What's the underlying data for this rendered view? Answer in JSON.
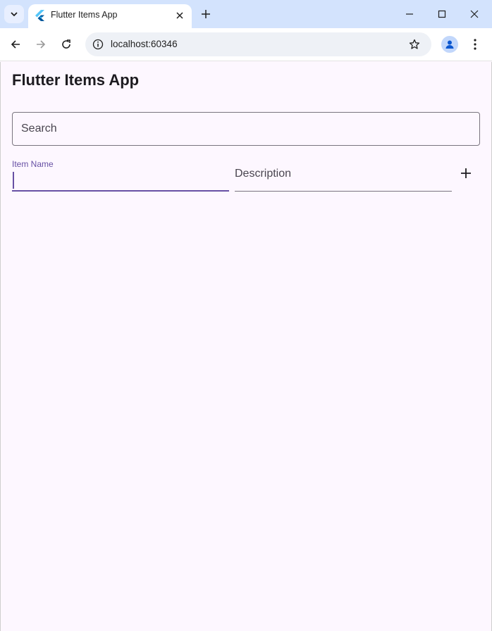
{
  "browser": {
    "tab_title": "Flutter Items App",
    "url": "localhost:60346"
  },
  "app": {
    "title": "Flutter Items App",
    "search": {
      "placeholder": "Search"
    },
    "form": {
      "item_name_label": "Item Name",
      "item_name_value": "",
      "description_label": "Description",
      "description_value": ""
    }
  },
  "colors": {
    "background": "#fdf7ff",
    "primary": "#6750a4",
    "outline": "#79747e",
    "tabstrip": "#d3e3fd"
  },
  "icons": [
    "chevron-down-icon",
    "flutter-logo-icon",
    "close-icon",
    "plus-icon",
    "minimize-icon",
    "maximize-icon",
    "close-window-icon",
    "back-arrow-icon",
    "forward-arrow-icon",
    "reload-icon",
    "site-info-icon",
    "star-icon",
    "profile-icon",
    "kebab-menu-icon",
    "add-icon"
  ]
}
